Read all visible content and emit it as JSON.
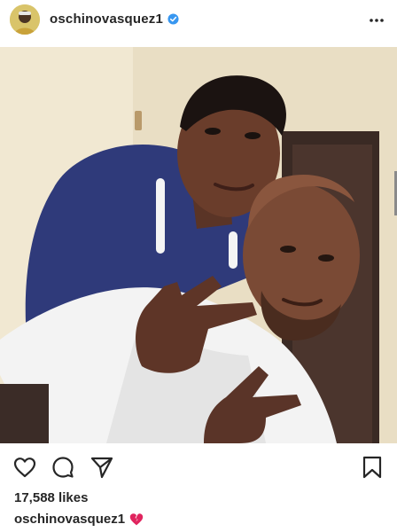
{
  "post": {
    "username": "oschinovasquez1",
    "verified": true,
    "likes": "17,588 likes",
    "caption": {
      "username": "oschinovasquez1",
      "emoji": "broken-heart"
    }
  },
  "icons": {
    "more": "more-options-icon",
    "like": "heart-icon",
    "comment": "comment-icon",
    "share": "send-icon",
    "save": "bookmark-icon",
    "verified": "verified-badge-icon"
  },
  "colors": {
    "text": "#262626",
    "verified_blue": "#3897f0",
    "broken_heart": "#e0245e"
  },
  "photo": {
    "description": "Teen in navy zip hoodie leaning over the shoulders of a bald man in a white t-shirt; both make peace signs."
  }
}
